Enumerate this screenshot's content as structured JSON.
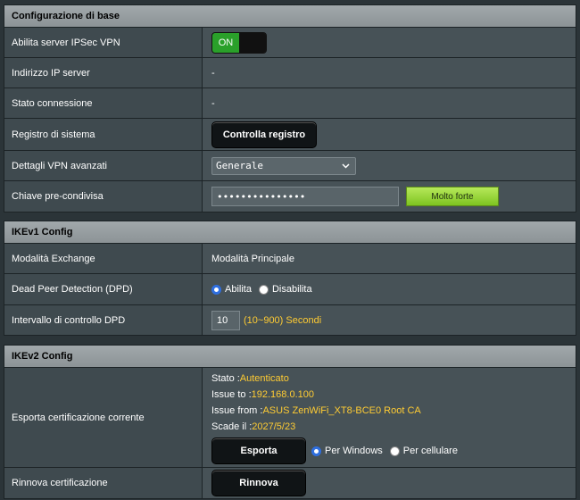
{
  "basic": {
    "title": "Configurazione di base",
    "vpn_label": "Abilita server IPSec VPN",
    "vpn_toggle": "ON",
    "server_ip_label": "Indirizzo IP server",
    "server_ip_value": "-",
    "conn_status_label": "Stato connessione",
    "conn_status_value": "-",
    "syslog_label": "Registro di sistema",
    "syslog_button": "Controlla registro",
    "advanced_label": "Dettagli VPN avanzati",
    "advanced_value": "Generale",
    "psk_label": "Chiave pre-condivisa",
    "psk_value": "•••••••••••••••",
    "psk_strength": "Molto forte"
  },
  "ikev1": {
    "title": "IKEv1 Config",
    "exchange_label": "Modalità Exchange",
    "exchange_value": "Modalità Principale",
    "dpd_label": "Dead Peer Detection (DPD)",
    "dpd_enable": "Abilita",
    "dpd_disable": "Disabilita",
    "dpd_interval_label": "Intervallo di controllo DPD",
    "dpd_interval_value": "10",
    "dpd_interval_hint": "(10~900) Secondi"
  },
  "ikev2": {
    "title": "IKEv2 Config",
    "export_label": "Esporta certificazione corrente",
    "status_key": "Stato : ",
    "status_value": "Autenticato",
    "issue_to_key": "Issue to : ",
    "issue_to_value": "192.168.0.100",
    "issue_from_key": "Issue from : ",
    "issue_from_value": "ASUS ZenWiFi_XT8-BCE0 Root CA",
    "expires_key": "Scade il : ",
    "expires_value": "2027/5/23",
    "export_button": "Esporta",
    "for_windows": "Per Windows",
    "for_mobile": "Per cellulare",
    "renew_label": "Rinnova certificazione",
    "renew_button": "Rinnova"
  }
}
